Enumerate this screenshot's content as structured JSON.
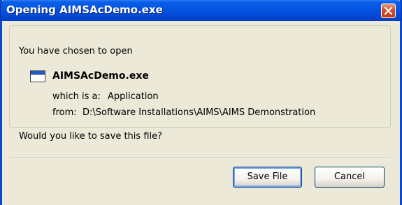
{
  "dialog": {
    "title": "Opening AIMSAcDemo.exe",
    "intro": "You have chosen to open",
    "file_name": "AIMSAcDemo.exe",
    "type_label": "which is a:",
    "type_value": "Application",
    "from_label": "from:",
    "from_value": "D:\\Software Installations\\AIMS\\AIMS Demonstration",
    "question": "Would you like to save this file?",
    "buttons": {
      "save": "Save File",
      "cancel": "Cancel"
    }
  },
  "colors": {
    "titlebar": "#0454e0",
    "close_button": "#d9502d",
    "dialog_background": "#ece9d8"
  },
  "icons": {
    "close": "close-icon",
    "file": "application-window-icon"
  }
}
